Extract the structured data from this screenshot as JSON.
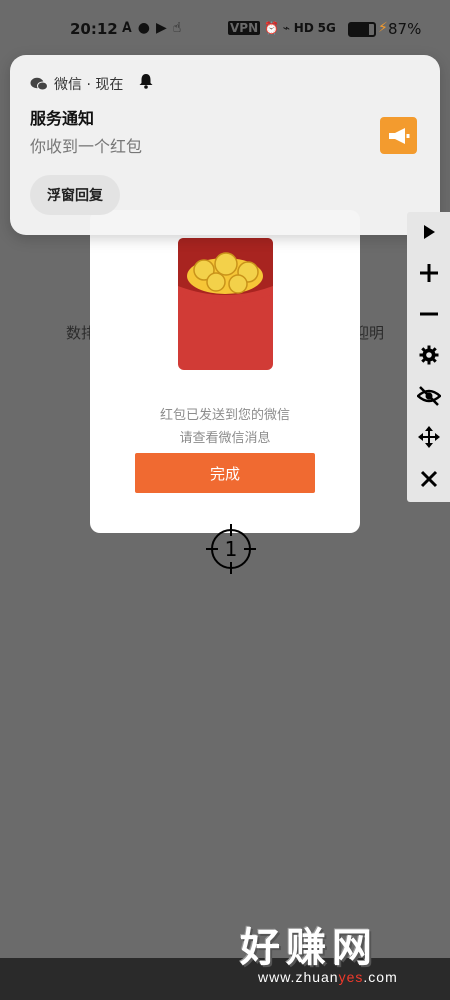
{
  "status_bar": {
    "time": "20:12",
    "left_icons": [
      "A-icon",
      "wechat-icon",
      "video-icon",
      "touch-icon"
    ],
    "vpn_label": "VPN",
    "hd_label": "HD",
    "signal_label": "5G",
    "battery_percent": "87%",
    "battery_level": 0.87
  },
  "background": {
    "left_fragment": "数排",
    "right_fragment": "迎明"
  },
  "dialog": {
    "message_line1": "红包已发送到您的微信",
    "message_line2": "请查看微信消息",
    "done_label": "完成",
    "done_color": "#f06a31",
    "envelope_color": "#d13b36"
  },
  "marker": {
    "number": "1"
  },
  "notification": {
    "app_name": "微信 · 现在",
    "title": "服务通知",
    "body": "你收到一个红包",
    "reply_label": "浮窗回复",
    "icon_color": "#f39b2e",
    "app_icon": "wechat-icon",
    "bell_icon": "bell-icon",
    "action_icon": "megaphone-icon"
  },
  "toolbar": {
    "tools": [
      "play-icon",
      "plus-icon",
      "minus-icon",
      "gear-icon",
      "eye-off-icon",
      "move-icon",
      "close-icon"
    ]
  },
  "watermark": {
    "text": "好赚网",
    "url_prefix": "www.zhuan",
    "url_highlight": "yes",
    "url_suffix": ".com"
  }
}
